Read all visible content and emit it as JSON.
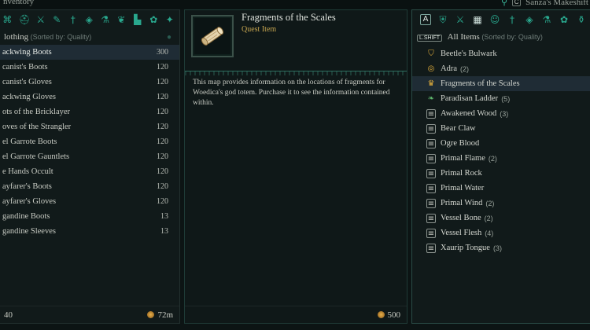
{
  "topbar": {
    "title": "nventory",
    "key": "C",
    "right_title": "Sanza's Makeshift"
  },
  "left": {
    "category_icons": [
      "rune-icon",
      "helmet-icon",
      "crossed-swords-icon",
      "feather-icon",
      "sword-icon",
      "gem-icon",
      "flask-icon",
      "leaf-icon",
      "anvil-icon",
      "herb-icon",
      "sparkle-icon"
    ],
    "heading": "lothing",
    "sort": "(Sorted by: Quality)",
    "items": [
      {
        "name": "ackwing Boots",
        "value": "300",
        "selected": true
      },
      {
        "name": "canist's Boots",
        "value": "120"
      },
      {
        "name": "canist's Gloves",
        "value": "120"
      },
      {
        "name": "ackwing Gloves",
        "value": "120"
      },
      {
        "name": "ots of the Bricklayer",
        "value": "120"
      },
      {
        "name": "oves of the Strangler",
        "value": "120"
      },
      {
        "name": "el Garrote Boots",
        "value": "120"
      },
      {
        "name": "el Garrote Gauntlets",
        "value": "120"
      },
      {
        "name": "e Hands Occult",
        "value": "120"
      },
      {
        "name": "ayfarer's Boots",
        "value": "120"
      },
      {
        "name": "ayfarer's Gloves",
        "value": "120"
      },
      {
        "name": "gandine Boots",
        "value": "13"
      },
      {
        "name": "gandine Sleeves",
        "value": "13"
      }
    ],
    "footer_left": "40",
    "footer_right": "72m"
  },
  "middle": {
    "title": "Fragments of the Scales",
    "subtitle": "Quest Item",
    "description": "This map provides information on the locations of fragments for Woedica's god totem. Purchase it to see the information contained within.",
    "price": "500"
  },
  "right": {
    "key_a": "A",
    "shift_label": "L.SHIFT",
    "heading": "All Items",
    "sort": "(Sorted by: Quality)",
    "items": [
      {
        "name": "Beetle's Bulwark",
        "count": "",
        "icon": "shield-icon"
      },
      {
        "name": "Adra",
        "count": "(2)",
        "icon": "ring-icon"
      },
      {
        "name": "Fragments of the Scales",
        "count": "",
        "icon": "crown-icon",
        "selected": true
      },
      {
        "name": "Paradisan Ladder",
        "count": "(5)",
        "icon": "leaf-icon"
      },
      {
        "name": "Awakened Wood",
        "count": "(3)",
        "icon": "scroll-icon"
      },
      {
        "name": "Bear Claw",
        "count": "",
        "icon": "scroll-icon"
      },
      {
        "name": "Ogre Blood",
        "count": "",
        "icon": "scroll-icon"
      },
      {
        "name": "Primal Flame",
        "count": "(2)",
        "icon": "scroll-icon"
      },
      {
        "name": "Primal Rock",
        "count": "",
        "icon": "scroll-icon"
      },
      {
        "name": "Primal Water",
        "count": "",
        "icon": "scroll-icon"
      },
      {
        "name": "Primal Wind",
        "count": "(2)",
        "icon": "scroll-icon"
      },
      {
        "name": "Vessel Bone",
        "count": "(2)",
        "icon": "scroll-icon"
      },
      {
        "name": "Vessel Flesh",
        "count": "(4)",
        "icon": "scroll-icon"
      },
      {
        "name": "Xaurip Tongue",
        "count": "(3)",
        "icon": "scroll-icon"
      }
    ]
  },
  "colors": {
    "accent": "#29a88e",
    "gold": "#c5a44f",
    "selection": "#1f2c35"
  }
}
